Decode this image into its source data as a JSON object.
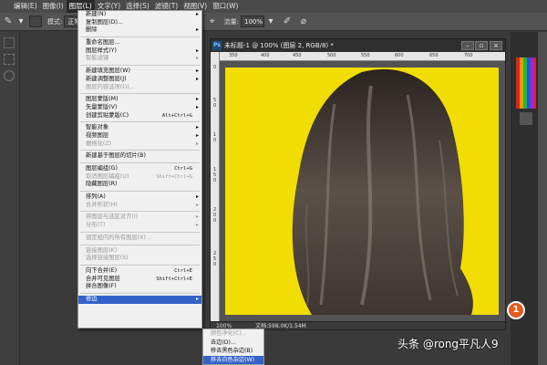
{
  "menubar": {
    "items": [
      "编辑(E)",
      "图像(I)",
      "图层(L)",
      "文字(Y)",
      "选择(S)",
      "滤镜(T)",
      "视图(V)",
      "窗口(W)"
    ]
  },
  "optbar": {
    "mode_label": "模式:",
    "mode_value": "正常",
    "flow_label": "流量:",
    "flow_value": "100%"
  },
  "doc": {
    "title": "未标题-1 @ 100% (图层 2, RGB/8) *",
    "ps_badge": "Ps",
    "zoom": "100%",
    "doc_size": "文档:598.0K/1.54M",
    "hruler": [
      "350",
      "400",
      "450",
      "500",
      "550",
      "600",
      "650",
      "700"
    ],
    "vruler": [
      "0",
      "5",
      "0",
      "1",
      "0",
      "1",
      "5",
      "0",
      "2",
      "0",
      "0",
      "2",
      "5",
      "0"
    ]
  },
  "dropdown": {
    "items": [
      {
        "label": "新建(N)",
        "arrow": true
      },
      {
        "label": "复制图层(D)..."
      },
      {
        "label": "删除",
        "arrow": true
      },
      {
        "sep": true
      },
      {
        "label": "重命名图层..."
      },
      {
        "label": "图层样式(Y)",
        "arrow": true
      },
      {
        "label": "智能滤镜",
        "disabled": true,
        "arrow": true
      },
      {
        "sep": true
      },
      {
        "label": "新建填充图层(W)",
        "arrow": true
      },
      {
        "label": "新建调整图层(J)",
        "arrow": true
      },
      {
        "label": "图层内容选项(O)...",
        "disabled": true
      },
      {
        "sep": true
      },
      {
        "label": "图层蒙版(M)",
        "arrow": true
      },
      {
        "label": "矢量蒙版(V)",
        "arrow": true
      },
      {
        "label": "创建剪贴蒙版(C)",
        "shortcut": "Alt+Ctrl+G"
      },
      {
        "sep": true
      },
      {
        "label": "智能对象",
        "arrow": true
      },
      {
        "label": "视频图层",
        "arrow": true
      },
      {
        "label": "栅格化(Z)",
        "disabled": true,
        "arrow": true
      },
      {
        "sep": true
      },
      {
        "label": "新建基于图层的切片(B)"
      },
      {
        "sep": true
      },
      {
        "label": "图层编组(G)",
        "shortcut": "Ctrl+G"
      },
      {
        "label": "取消图层编组(U)",
        "shortcut": "Shift+Ctrl+G",
        "disabled": true
      },
      {
        "label": "隐藏图层(R)"
      },
      {
        "sep": true
      },
      {
        "label": "排列(A)",
        "arrow": true
      },
      {
        "label": "合并形状(H)",
        "disabled": true,
        "arrow": true
      },
      {
        "sep": true
      },
      {
        "label": "将图层与选区对齐(I)",
        "disabled": true,
        "arrow": true
      },
      {
        "label": "分布(T)",
        "disabled": true,
        "arrow": true
      },
      {
        "sep": true
      },
      {
        "label": "锁定组内的所有图层(X)...",
        "disabled": true
      },
      {
        "sep": true
      },
      {
        "label": "链接图层(K)",
        "disabled": true
      },
      {
        "label": "选择链接图层(S)",
        "disabled": true
      },
      {
        "sep": true
      },
      {
        "label": "向下合并(E)",
        "shortcut": "Ctrl+E"
      },
      {
        "label": "合并可见图层",
        "shortcut": "Shift+Ctrl+E"
      },
      {
        "label": "拼合图像(F)"
      },
      {
        "sep": true
      },
      {
        "label": "修边",
        "arrow": true,
        "highlight": true
      }
    ]
  },
  "submenu": {
    "items": [
      {
        "label": "颜色净化(C)...",
        "disabled": true
      },
      {
        "label": "去边(D)..."
      },
      {
        "label": "移去黑色杂边(B)"
      },
      {
        "label": "移去白色杂边(W)",
        "highlight": true
      }
    ]
  },
  "annotation": {
    "badge": "1",
    "color": "#e65a1a"
  },
  "watermark": "头条 @rong平凡人9",
  "colors": {
    "canvas": "#f2dd02",
    "highlight": "#3363c9",
    "menu_bg": "#f0f0f0"
  }
}
